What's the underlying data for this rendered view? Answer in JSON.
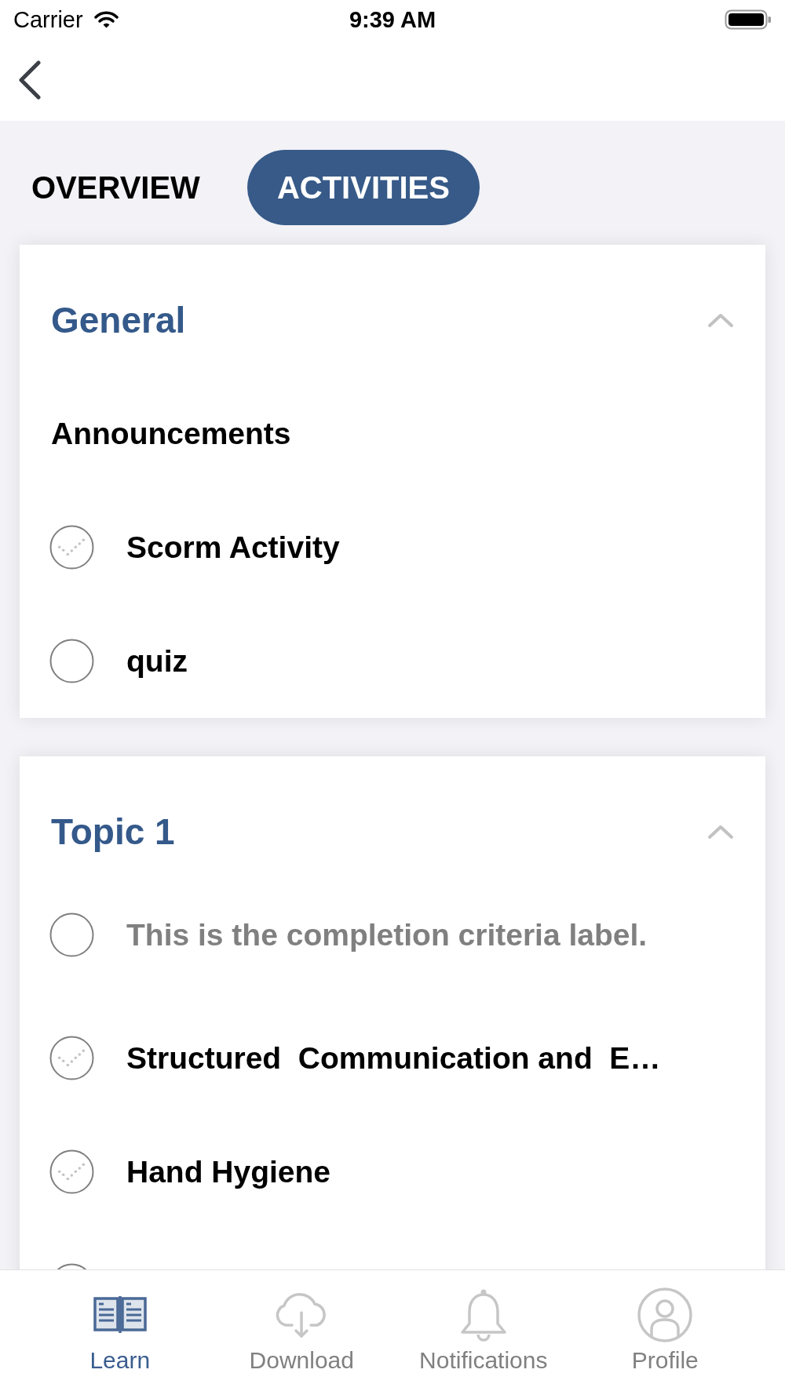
{
  "status_bar": {
    "carrier": "Carrier",
    "time": "9:39 AM"
  },
  "tabs": [
    {
      "label": "OVERVIEW",
      "selected": false
    },
    {
      "label": "ACTIVITIES",
      "selected": true
    }
  ],
  "sections": [
    {
      "title": "General",
      "expanded": true,
      "items": [
        {
          "kind": "link",
          "label": "Announcements"
        },
        {
          "kind": "activity",
          "label": "Scorm Activity",
          "checked": true
        },
        {
          "kind": "activity",
          "label": "quiz",
          "checked": false
        }
      ]
    },
    {
      "title": "Topic 1",
      "expanded": true,
      "items": [
        {
          "kind": "criteria",
          "label": "This is the completion criteria label.",
          "checked": false
        },
        {
          "kind": "activity",
          "label": "Structured  Communication and  E…",
          "checked": true
        },
        {
          "kind": "activity",
          "label": "Hand Hygiene",
          "checked": true
        },
        {
          "kind": "activity"
        }
      ]
    }
  ],
  "bottom_nav": [
    {
      "label": "Learn",
      "selected": true
    },
    {
      "label": "Download",
      "selected": false
    },
    {
      "label": "Notifications",
      "selected": false
    },
    {
      "label": "Profile",
      "selected": false
    }
  ]
}
